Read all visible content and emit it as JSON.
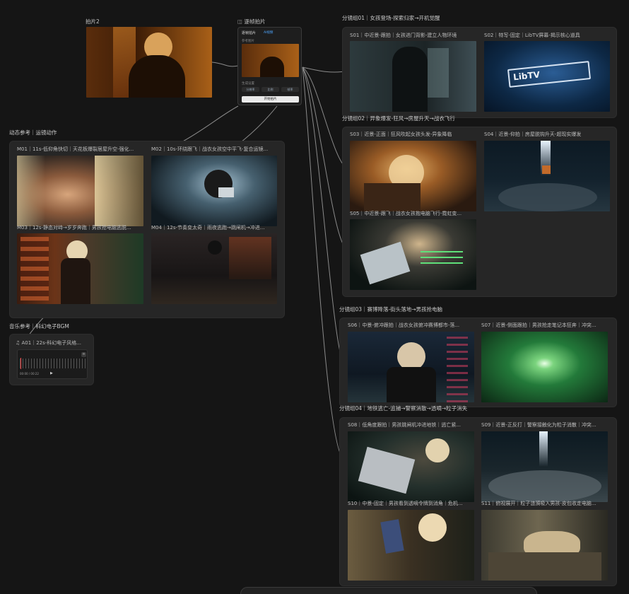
{
  "canvas": {
    "photo_node": {
      "label": "拍片2"
    },
    "keyframe_node": {
      "title": "逐帧拍片",
      "inner_title": "逐帧拍片",
      "inner_badge": "AI视频",
      "upload_label": "参考图片",
      "params_label": "生成设置",
      "options": [
        "分辨率",
        "比例",
        "帧率"
      ],
      "generate_button": "开始拍片"
    },
    "motion_group": {
      "label": "动态参考｜运镜动作",
      "items": [
        {
          "caption": "M01｜11s-低仰角快切｜天花板爆裂居屋升空-强化..."
        },
        {
          "caption": "M02｜10s-环绕跟飞｜战衣女孩空中平飞-复合运镜..."
        },
        {
          "caption": "M03｜12s-静态对峙→岁岁奔跑｜男孩抢电脑逃脱..."
        },
        {
          "caption": "M04｜12s-节奏变太奇｜雨夜逃跑→跳闸机→冲进..."
        }
      ]
    },
    "music_group": {
      "label": "音乐参考｜科幻电子BGM",
      "item_caption": "A01｜22s-科幻电子风格...",
      "time": "00:00 / 00:22"
    },
    "storyboard_groups": [
      {
        "label": "分镜组01｜女孩登场-探索归家→开机觉醒",
        "shots": [
          {
            "caption": "S01｜中近景-跟拍｜女孩进门背影-建立人物环境"
          },
          {
            "caption": "S02｜特写-固定｜LibTV屏幕-揭示核心道具"
          }
        ],
        "screen_text": "LibTV"
      },
      {
        "label": "分镜组02｜异象爆发-狂风→房屋升天→战衣飞行",
        "shots": [
          {
            "caption": "S03｜近景-正面｜狂风吹起女孩头发-异象降临"
          },
          {
            "caption": "S04｜近景-仰拍｜房屋脱钩升天-超现实爆发"
          },
          {
            "caption": "S05｜中近景-跟飞｜战衣女孩抱电脑飞行-霓虹变..."
          }
        ]
      },
      {
        "label": "分镜组03｜赛博降落-街头落地→男孩抢电脑",
        "shots": [
          {
            "caption": "S06｜中景-俯冲跟拍｜战衣女孩俯冲赛博都市-落..."
          },
          {
            "caption": "S07｜近景-侧面跟拍｜男孩抢走笔记本狂奔｜冲突..."
          }
        ]
      },
      {
        "label": "分镜组04｜地铁逃亡-追捕→警察消散→透嘀→粒子消失",
        "shots": [
          {
            "caption": "S08｜低角度跟拍｜男孩跳闸机冲进地铁｜逃亡紧..."
          },
          {
            "caption": "S09｜近景-正反打｜警察接触化为粒子消散｜冲突..."
          },
          {
            "caption": "S10｜中景-固定｜男孩看到透嘀令牌到消角｜危机..."
          },
          {
            "caption": "S11｜俯视展开｜粒子涟漪吸入男孩-皮包收走电脑..."
          }
        ]
      }
    ]
  },
  "colors": {
    "bg": "#151515",
    "panel": "#262626",
    "link": "#8a8a8a",
    "accent_green": "#2cbf5a"
  }
}
